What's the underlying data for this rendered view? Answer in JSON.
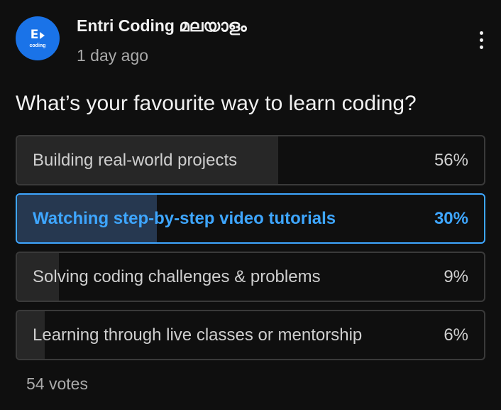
{
  "channel": {
    "name": "Entri Coding മലയാളം",
    "avatar_logo": "E",
    "avatar_sub": "coding"
  },
  "post": {
    "timestamp": "1 day ago",
    "question": "What’s your favourite way to learn coding?"
  },
  "poll": {
    "options": [
      {
        "label": "Building real-world projects",
        "percent_label": "56%",
        "fill_fraction": 0.56,
        "selected": false
      },
      {
        "label": "Watching step-by-step video tutorials",
        "percent_label": "30%",
        "fill_fraction": 0.3,
        "selected": true
      },
      {
        "label": "Solving coding challenges & problems",
        "percent_label": "9%",
        "fill_fraction": 0.09,
        "selected": false
      },
      {
        "label": "Learning through live classes or mentorship",
        "percent_label": "6%",
        "fill_fraction": 0.06,
        "selected": false
      }
    ],
    "votes": "54 votes"
  },
  "icons": {
    "menu": "vertical-ellipsis-icon"
  },
  "colors": {
    "background": "#0f0f0f",
    "accent": "#3ea6ff",
    "avatar": "#1a73e8"
  }
}
